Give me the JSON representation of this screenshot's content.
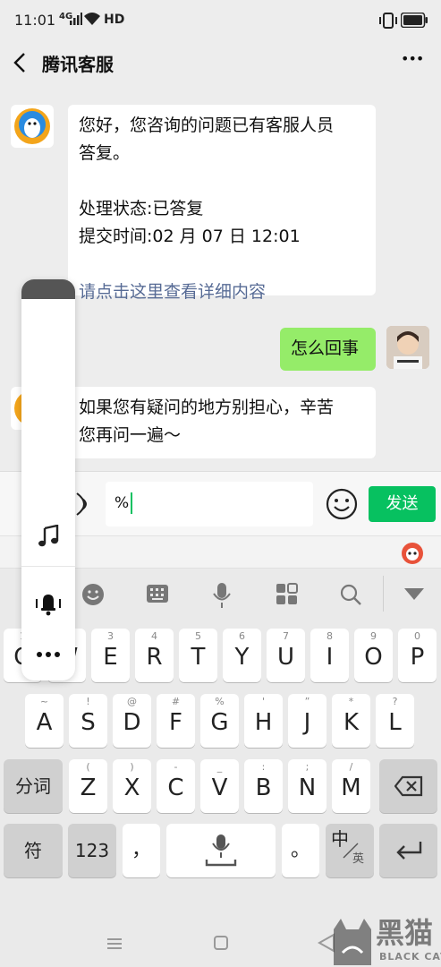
{
  "status": {
    "time": "11:01",
    "signal": "4G",
    "network": "HD"
  },
  "nav": {
    "title": "腾讯客服",
    "more": "•••"
  },
  "messages": {
    "m1": {
      "line1": "您好，您咨询的问题已有客服人员",
      "line2": "答复。",
      "status_line": "处理状态:已答复",
      "time_line": "提交时间:02 月 07 日 12:01",
      "link": "请点击这里查看详细内容"
    },
    "m2": {
      "text": "怎么回事"
    },
    "m3": {
      "line1": "如果您有疑问的地方别担心，辛苦",
      "line2": "您再问一遍～"
    }
  },
  "input": {
    "value": "%",
    "send_label": "发送"
  },
  "keyboard": {
    "row1": [
      {
        "sub": "1",
        "main": "Q"
      },
      {
        "sub": "2",
        "main": "W"
      },
      {
        "sub": "3",
        "main": "E"
      },
      {
        "sub": "4",
        "main": "R"
      },
      {
        "sub": "5",
        "main": "T"
      },
      {
        "sub": "6",
        "main": "Y"
      },
      {
        "sub": "7",
        "main": "U"
      },
      {
        "sub": "8",
        "main": "I"
      },
      {
        "sub": "9",
        "main": "O"
      },
      {
        "sub": "0",
        "main": "P"
      }
    ],
    "row2": [
      {
        "sub": "~",
        "main": "A"
      },
      {
        "sub": "!",
        "main": "S"
      },
      {
        "sub": "@",
        "main": "D"
      },
      {
        "sub": "#",
        "main": "F"
      },
      {
        "sub": "%",
        "main": "G"
      },
      {
        "sub": "'",
        "main": "H"
      },
      {
        "sub": "”",
        "main": "J"
      },
      {
        "sub": "*",
        "main": "K"
      },
      {
        "sub": "?",
        "main": "L"
      }
    ],
    "row3": [
      {
        "sub": "(",
        "main": "Z"
      },
      {
        "sub": ")",
        "main": "X"
      },
      {
        "sub": "-",
        "main": "C"
      },
      {
        "sub": "_",
        "main": "V"
      },
      {
        "sub": ":",
        "main": "B"
      },
      {
        "sub": ";",
        "main": "N"
      },
      {
        "sub": "/",
        "main": "M"
      }
    ],
    "fenci": "分词",
    "fu": "符",
    "num": "123",
    "comma": "，",
    "period": "。",
    "zh": "中",
    "en": "英"
  },
  "watermark": {
    "cn": "黑猫",
    "en": "BLACK CAT"
  },
  "colors": {
    "send": "#07c160",
    "mine_bubble": "#95ec69",
    "link": "#576b95",
    "cursor": "#07c160"
  }
}
